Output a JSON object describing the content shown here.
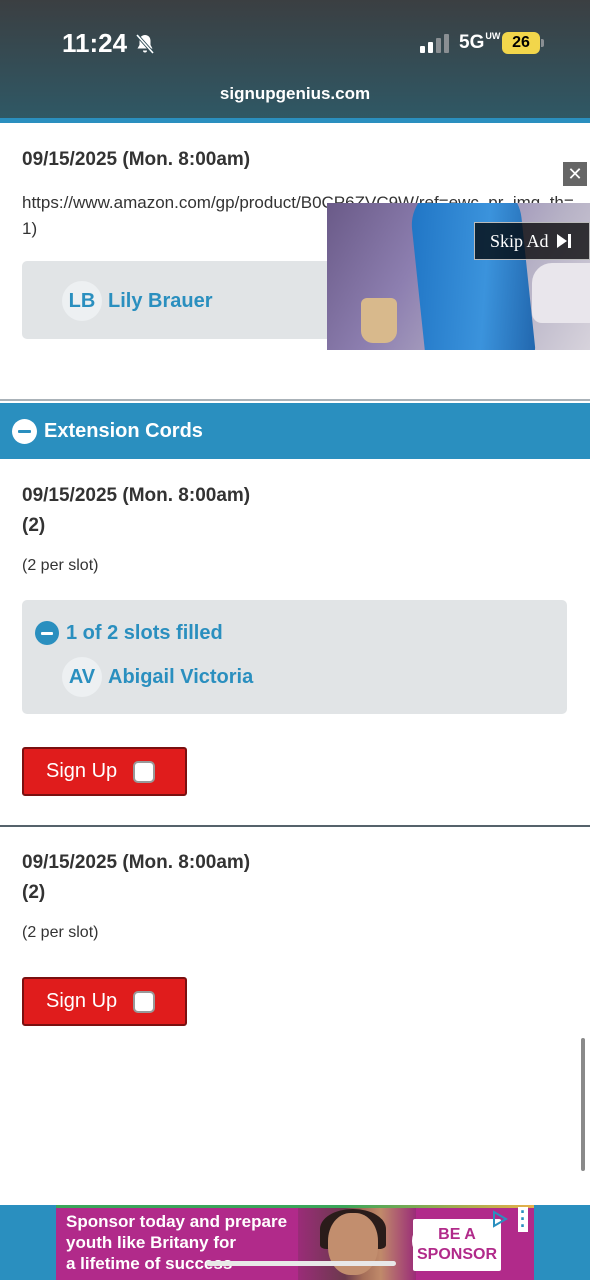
{
  "status_bar": {
    "time": "11:24",
    "network": "5G",
    "network_sup": "UW",
    "battery": "26"
  },
  "browser": {
    "url": "signupgenius.com"
  },
  "first_item": {
    "date": "09/15/2025 (Mon. 8:00am)",
    "link": "https://www.amazon.com/gp/product/B0CP6ZVC9W/ref=ewc_pr_img_th=1)",
    "volunteer": {
      "initials": "LB",
      "name": "Lily Brauer"
    }
  },
  "video_ad": {
    "skip_label": "Skip Ad",
    "close_label": "✕"
  },
  "section": {
    "title": "Extension Cords"
  },
  "slots": [
    {
      "date": "09/15/2025 (Mon. 8:00am)",
      "count": "(2)",
      "per_slot": "(2 per slot)",
      "filled_label": "1 of 2 slots filled",
      "volunteer": {
        "initials": "AV",
        "name": "Abigail Victoria"
      },
      "signup_label": "Sign Up"
    },
    {
      "date": "09/15/2025 (Mon. 8:00am)",
      "count": "(2)",
      "per_slot": "(2 per slot)",
      "signup_label": "Sign Up"
    }
  ],
  "banner_ad": {
    "line1": "Sponsor today and prepare",
    "line2": "youth like Britany for",
    "line3": "a lifetime of success",
    "cta_line1": "BE A",
    "cta_line2": "SPONSOR"
  },
  "colors": {
    "accent": "#2a8fbf",
    "signup_red": "#e01c1c",
    "filled_bg": "#e1e4e6",
    "banner_magenta": "#b12a8a"
  }
}
